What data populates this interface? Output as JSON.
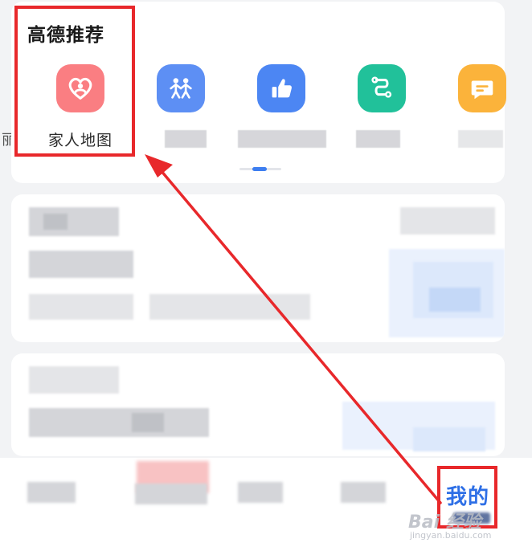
{
  "recommend": {
    "title": "高德推荐",
    "apps": [
      {
        "label": "家人地图",
        "icon": "family-map-heart-icon",
        "color": "#fa7e82"
      },
      {
        "label": "",
        "icon": "two-people-icon",
        "color": "#5d8ff4"
      },
      {
        "label": "",
        "icon": "thumbs-up-icon",
        "color": "#4c86f3"
      },
      {
        "label": "",
        "icon": "route-icon",
        "color": "#21c19a"
      },
      {
        "label": "",
        "icon": "message-icon",
        "color": "#fbb33b"
      }
    ]
  },
  "bottom_nav": {
    "mine_label": "我的"
  },
  "watermark": {
    "main": "Bai 经验",
    "sub": "jingyan.baidu.com"
  },
  "colors": {
    "accent_blue": "#2e6fe6",
    "highlight_red": "#e8282b"
  }
}
